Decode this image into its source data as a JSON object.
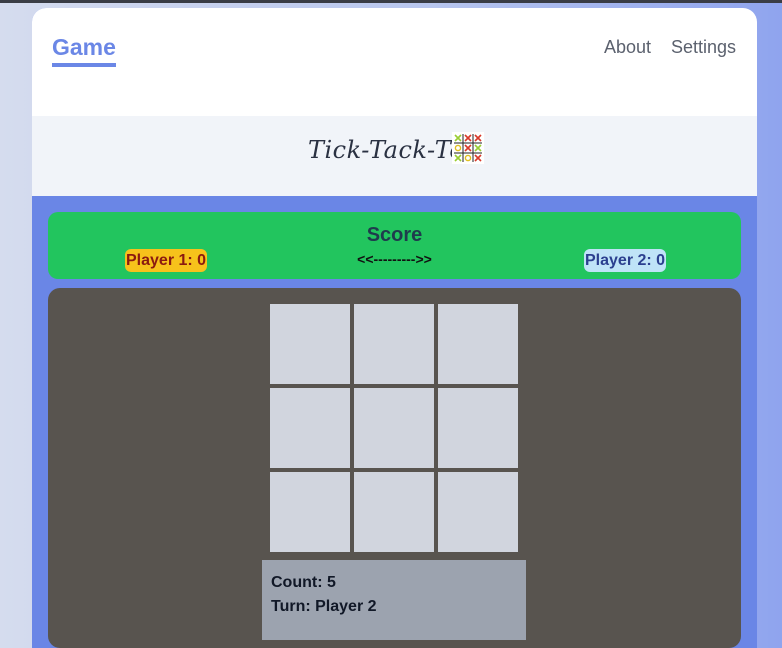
{
  "nav": {
    "brand": "Game",
    "links": [
      "About",
      "Settings"
    ]
  },
  "banner": {
    "title": "Tick-Tack-Toe",
    "logo_icon": "tic-tac-toe-icon"
  },
  "score": {
    "title": "Score",
    "player1": "Player 1: 0",
    "separator": "<<--------->>",
    "player2": "Player 2: 0"
  },
  "board": {
    "cells": [
      "",
      "",
      "",
      "",
      "",
      "",
      "",
      "",
      ""
    ]
  },
  "status": {
    "count": "Count: 5",
    "turn": "Turn: Player 2"
  },
  "colors": {
    "accent": "#6b87e6",
    "score_bar": "#22c55e",
    "player1_badge": "#f7c21b",
    "player2_badge": "#bfe3f7",
    "board_bg": "#58544f",
    "cell": "#d1d5de"
  }
}
